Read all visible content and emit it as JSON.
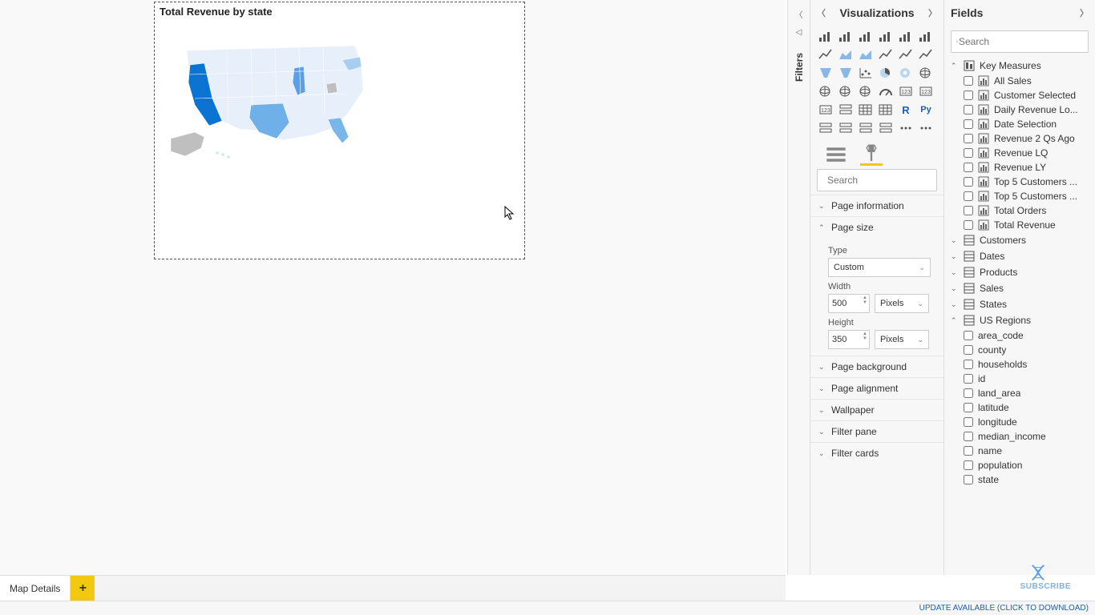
{
  "canvas": {
    "visual_title": "Total Revenue by state",
    "page_tab": "Map Details",
    "add_tab": "+"
  },
  "filters_pane": {
    "label": "Filters"
  },
  "viz_pane": {
    "title": "Visualizations",
    "search_placeholder": "Search",
    "tabs": {
      "fields_tab": "fields",
      "format_tab": "format"
    },
    "sections": {
      "page_info": "Page information",
      "page_size": "Page size",
      "page_bg": "Page background",
      "page_align": "Page alignment",
      "wallpaper": "Wallpaper",
      "filter_pane": "Filter pane",
      "filter_cards": "Filter cards"
    },
    "page_size": {
      "type_label": "Type",
      "type_value": "Custom",
      "width_label": "Width",
      "width_value": "500",
      "width_unit": "Pixels",
      "height_label": "Height",
      "height_value": "350",
      "height_unit": "Pixels"
    },
    "gallery_icons": [
      "stacked-bar",
      "stacked-column",
      "clustered-bar",
      "clustered-column",
      "hundred-bar",
      "hundred-column",
      "line",
      "area",
      "stacked-area",
      "line-stacked-col",
      "line-clustered-col",
      "ribbon",
      "waterfall",
      "funnel",
      "scatter",
      "pie",
      "donut",
      "treemap",
      "map",
      "filled-map",
      "shape-map",
      "gauge",
      "card",
      "multi-card",
      "kpi",
      "slicer",
      "table",
      "matrix",
      "r-script",
      "py-script",
      "key-influencer",
      "decomp-tree",
      "qna",
      "paginated",
      "more",
      "ellipsis"
    ]
  },
  "fields_pane": {
    "title": "Fields",
    "search_placeholder": "Search",
    "tables": [
      {
        "name": "Key Measures",
        "expanded": true,
        "icon": "measure-group",
        "fields": [
          {
            "name": "All Sales",
            "icon": "measure"
          },
          {
            "name": "Customer Selected",
            "icon": "measure"
          },
          {
            "name": "Daily Revenue Lo...",
            "icon": "measure"
          },
          {
            "name": "Date Selection",
            "icon": "measure"
          },
          {
            "name": "Revenue 2 Qs Ago",
            "icon": "measure"
          },
          {
            "name": "Revenue LQ",
            "icon": "measure"
          },
          {
            "name": "Revenue LY",
            "icon": "measure"
          },
          {
            "name": "Top 5 Customers ...",
            "icon": "measure"
          },
          {
            "name": "Top 5 Customers ...",
            "icon": "measure"
          },
          {
            "name": "Total Orders",
            "icon": "measure"
          },
          {
            "name": "Total Revenue",
            "icon": "measure"
          }
        ]
      },
      {
        "name": "Customers",
        "expanded": false,
        "icon": "table"
      },
      {
        "name": "Dates",
        "expanded": false,
        "icon": "table"
      },
      {
        "name": "Products",
        "expanded": false,
        "icon": "table"
      },
      {
        "name": "Sales",
        "expanded": false,
        "icon": "table"
      },
      {
        "name": "States",
        "expanded": false,
        "icon": "table"
      },
      {
        "name": "US Regions",
        "expanded": true,
        "icon": "table",
        "fields": [
          {
            "name": "area_code",
            "icon": "column"
          },
          {
            "name": "county",
            "icon": "column"
          },
          {
            "name": "households",
            "icon": "column"
          },
          {
            "name": "id",
            "icon": "column"
          },
          {
            "name": "land_area",
            "icon": "column"
          },
          {
            "name": "latitude",
            "icon": "column"
          },
          {
            "name": "longitude",
            "icon": "column"
          },
          {
            "name": "median_income",
            "icon": "column"
          },
          {
            "name": "name",
            "icon": "column"
          },
          {
            "name": "population",
            "icon": "column"
          },
          {
            "name": "state",
            "icon": "column"
          }
        ]
      }
    ]
  },
  "status_bar": {
    "update_text": "UPDATE AVAILABLE (CLICK TO DOWNLOAD)"
  },
  "subscribe": "SUBSCRIBE",
  "chart_data": {
    "type": "map",
    "geography": "US States",
    "title": "Total Revenue by state",
    "color_field": "Total Revenue",
    "color_gradient": [
      "#e6effa",
      "#0b73d1"
    ],
    "notes": "Choropleth shading; California darkest, Texas/Illinois/Florida medium, most others light; Alaska/West Virginia grey (no data).",
    "highlight_states_approx": {
      "California": "high",
      "Texas": "medium",
      "Illinois": "medium",
      "Florida": "medium",
      "New York": "medium-light",
      "Washington": "light",
      "Others": "very-light"
    }
  }
}
